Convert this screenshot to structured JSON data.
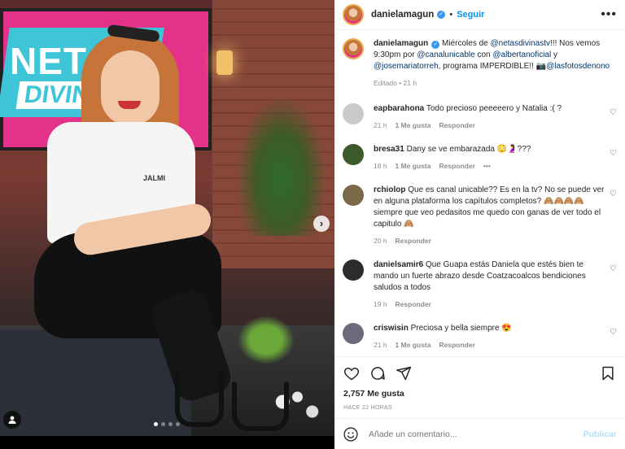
{
  "post": {
    "username": "danielamagun",
    "follow_label": "Seguir",
    "separator": "•",
    "more_icon": "•••",
    "dots_count": 4,
    "active_dot": 0,
    "screen_text_1": "NETAS",
    "screen_text_2": "DIVINAS",
    "shirt_text": "JALMI"
  },
  "caption": {
    "username": "danielamagun",
    "text_1": " Miércoles de ",
    "mention_1": "@netasdivinastv",
    "text_2": "!!! Nos vemos 9:30pm por ",
    "mention_2": "@canalunicable",
    "text_3": " con ",
    "mention_3": "@albertanoficial",
    "text_4": " y ",
    "mention_4": "@josemariatorreh",
    "text_5": ", programa IMPERDIBLE!! 📷",
    "mention_5": "@lasfotosdenono",
    "edited": "Editado",
    "time": "21 h"
  },
  "comments": [
    {
      "user": "eapbarahona",
      "text": "Todo precioso peeeeero y Natalia :( ?",
      "time": "21 h",
      "likes": "1 Me gusta",
      "reply": "Responder",
      "extra": ""
    },
    {
      "user": "bresa31",
      "text": "Dany se ve embarazada 😳🤰???",
      "time": "18 h",
      "likes": "1 Me gusta",
      "reply": "Responder",
      "extra": "•••"
    },
    {
      "user": "rchiolop",
      "text": "Que es canal unicable?? Es en la tv? No se puede ver en alguna plataforma los capítulos completos? 🙈🙈🙈🙈 siempre que veo pedasitos me quedo con ganas de ver todo el capitulo 🙈",
      "time": "20 h",
      "likes": "",
      "reply": "Responder",
      "extra": ""
    },
    {
      "user": "danielsamir6",
      "text": "Que Guapa estás Daniela que estés bien te mando un fuerte abrazo desde Coatzacoalcos bendiciones saludos a todos",
      "time": "19 h",
      "likes": "",
      "reply": "Responder",
      "extra": ""
    },
    {
      "user": "criswisin",
      "text": "Preciosa y bella siempre 😍",
      "time": "21 h",
      "likes": "1 Me gusta",
      "reply": "Responder",
      "extra": ""
    }
  ],
  "stats": {
    "likes": "2,757 Me gusta",
    "ago": "HACE 22 HORAS"
  },
  "comment_box": {
    "placeholder": "Añade un comentario...",
    "publish": "Publicar"
  },
  "colors": {
    "accent": "#0095f6",
    "verified": "#3897f0",
    "publish_disabled": "#b2dffc"
  }
}
